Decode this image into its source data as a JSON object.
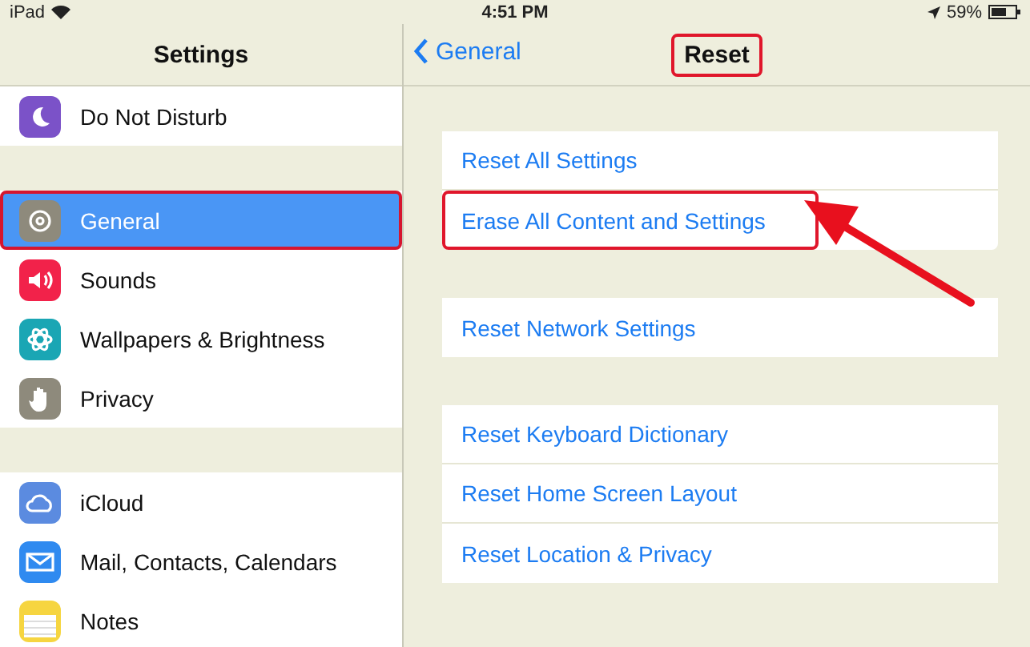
{
  "status_bar": {
    "device": "iPad",
    "time": "4:51 PM",
    "battery": "59%"
  },
  "sidebar": {
    "title": "Settings",
    "sections": [
      [
        {
          "label": "Do Not Disturb",
          "kind": "moon",
          "color": "#7b52c8",
          "selected": false,
          "highlighted": false
        }
      ],
      [
        {
          "label": "General",
          "kind": "gear",
          "color": "#8e8a7c",
          "selected": true,
          "highlighted": true
        },
        {
          "label": "Sounds",
          "kind": "speaker",
          "color": "#f2224a",
          "selected": false,
          "highlighted": false
        },
        {
          "label": "Wallpapers & Brightness",
          "kind": "flower",
          "color": "#1aa6b4",
          "selected": false,
          "highlighted": false
        },
        {
          "label": "Privacy",
          "kind": "hand",
          "color": "#8e8a7c",
          "selected": false,
          "highlighted": false
        }
      ],
      [
        {
          "label": "iCloud",
          "kind": "cloud",
          "color": "#5b8be0",
          "selected": false,
          "highlighted": false
        },
        {
          "label": "Mail, Contacts, Calendars",
          "kind": "mail",
          "color": "#2f8af0",
          "selected": false,
          "highlighted": false
        },
        {
          "label": "Notes",
          "kind": "notes",
          "color": "#f6d540",
          "selected": false,
          "highlighted": false
        }
      ]
    ]
  },
  "nav": {
    "back": "General",
    "title": "Reset",
    "title_highlighted": true
  },
  "groups": [
    [
      {
        "label": "Reset All Settings",
        "highlighted": false
      },
      {
        "label": "Erase All Content and Settings",
        "highlighted": true
      }
    ],
    [
      {
        "label": "Reset Network Settings",
        "highlighted": false
      }
    ],
    [
      {
        "label": "Reset Keyboard Dictionary",
        "highlighted": false
      },
      {
        "label": "Reset Home Screen Layout",
        "highlighted": false
      },
      {
        "label": "Reset Location & Privacy",
        "highlighted": false
      }
    ]
  ]
}
